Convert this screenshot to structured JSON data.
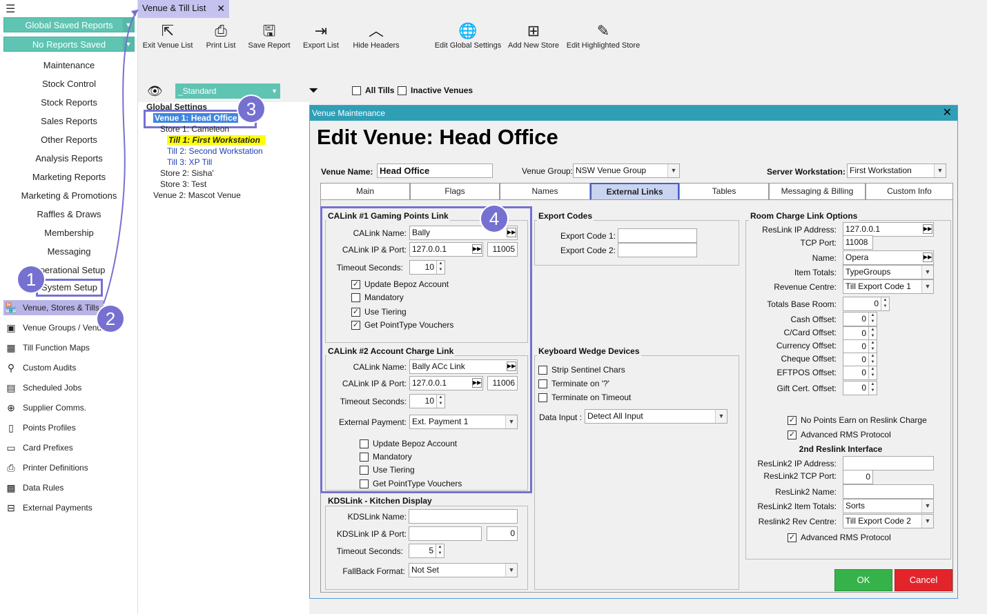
{
  "sidebar": {
    "dropdowns": [
      "Global Saved Reports",
      "No Reports Saved"
    ],
    "menu": [
      "Maintenance",
      "Stock Control",
      "Stock Reports",
      "Sales Reports",
      "Other Reports",
      "Analysis Reports",
      "Marketing Reports",
      "Marketing & Promotions",
      "Raffles & Draws",
      "Membership",
      "Messaging",
      "Operational Setup",
      "System Setup"
    ],
    "icon_items": [
      {
        "label": "Venue, Stores & Tills",
        "icon": "venue-icon"
      },
      {
        "label": "Venue Groups / Venues",
        "icon": "venue-groups-icon"
      },
      {
        "label": "Till Function Maps",
        "icon": "grid-icon"
      },
      {
        "label": "Custom Audits",
        "icon": "audit-icon"
      },
      {
        "label": "Scheduled Jobs",
        "icon": "calendar-icon"
      },
      {
        "label": "Supplier Comms.",
        "icon": "upload-icon"
      },
      {
        "label": "Points Profiles",
        "icon": "document-icon"
      },
      {
        "label": "Card Prefixes",
        "icon": "card-icon"
      },
      {
        "label": "Printer Definitions",
        "icon": "printer-icon"
      },
      {
        "label": "Data Rules",
        "icon": "table-icon"
      },
      {
        "label": "External Payments",
        "icon": "payment-icon"
      }
    ]
  },
  "tab": {
    "title": "Venue & Till List",
    "close": "✕"
  },
  "toolbar": [
    {
      "label": "Exit Venue List",
      "icon": "exit-icon"
    },
    {
      "label": "Print List",
      "icon": "print-icon"
    },
    {
      "label": "Save Report",
      "icon": "save-icon"
    },
    {
      "label": "Export List",
      "icon": "export-icon"
    },
    {
      "label": "Hide Headers",
      "icon": "chevron-up-icon"
    },
    {
      "label": "Edit Global Settings",
      "icon": "globe-icon"
    },
    {
      "label": "Add New Store",
      "icon": "add-store-icon"
    },
    {
      "label": "Edit Highlighted Store",
      "icon": "edit-store-icon"
    }
  ],
  "filter": {
    "view": "_Standard",
    "all_tills": "All Tills",
    "inactive_venues": "Inactive Venues"
  },
  "tree": {
    "global": "Global Settings",
    "venue1": "Venue 1: Head Office",
    "store1": "Store 1: Cameleon",
    "till1": "Till 1: First Workstation",
    "till2": "Till 2: Second Workstation",
    "till3": "Till 3: XP Till",
    "store2": "Store 2: Sisha'",
    "store3": "Store 3: Test",
    "venue2": "Venue 2: Mascot Venue"
  },
  "bubbles": [
    "1",
    "2",
    "3",
    "4"
  ],
  "dialog": {
    "title": "Venue Maintenance",
    "close": "✕",
    "heading": "Edit Venue: Head Office",
    "venue_name_label": "Venue Name:",
    "venue_name": "Head Office",
    "venue_group_label": "Venue Group:",
    "venue_group": "NSW Venue Group",
    "server_ws_label": "Server Workstation:",
    "server_ws": "First Workstation",
    "tabs": [
      "Main",
      "Flags",
      "Names",
      "External Links",
      "Tables",
      "Messaging & Billing",
      "Custom Info"
    ],
    "calink1": {
      "title": "CALink #1 Gaming Points Link",
      "name_label": "CALink Name:",
      "name": "Bally",
      "ip_label": "CALink IP & Port:",
      "ip": "127.0.0.1",
      "port": "11005",
      "timeout_label": "Timeout Seconds:",
      "timeout": "10",
      "checks": [
        {
          "label": "Update Bepoz Account",
          "checked": "✓"
        },
        {
          "label": "Mandatory",
          "checked": ""
        },
        {
          "label": "Use Tiering",
          "checked": "✓"
        },
        {
          "label": "Get PointType Vouchers",
          "checked": "✓"
        }
      ]
    },
    "calink2": {
      "title": "CALink #2 Account Charge Link",
      "name_label": "CALink Name:",
      "name": "Bally ACc Link",
      "ip_label": "CALink IP & Port:",
      "ip": "127.0.0.1",
      "port": "11006",
      "timeout_label": "Timeout Seconds:",
      "timeout": "10",
      "ext_label": "External Payment:",
      "ext": "Ext. Payment 1",
      "checks": [
        {
          "label": "Update Bepoz Account",
          "checked": ""
        },
        {
          "label": "Mandatory",
          "checked": ""
        },
        {
          "label": "Use Tiering",
          "checked": ""
        },
        {
          "label": "Get PointType Vouchers",
          "checked": ""
        }
      ]
    },
    "kds": {
      "title": "KDSLink - Kitchen Display",
      "name_label": "KDSLink Name:",
      "name": "",
      "ip_label": "KDSLink IP & Port:",
      "ip": "",
      "port": "0",
      "timeout_label": "Timeout Seconds:",
      "timeout": "5",
      "fallback_label": "FallBack Format:",
      "fallback": "Not Set"
    },
    "export": {
      "title": "Export Codes",
      "code1_label": "Export Code 1:",
      "code2_label": "Export Code 2:"
    },
    "wedge": {
      "title": "Keyboard Wedge Devices",
      "checks": [
        "Strip Sentinel Chars",
        "Terminate on '?'",
        "Terminate on Timeout"
      ],
      "data_input_label": "Data Input :",
      "data_input": "Detect All Input"
    },
    "room": {
      "title": "Room Charge Link Options",
      "ip_label": "ResLink  IP Address:",
      "ip": "127.0.0.1",
      "tcp_label": "TCP Port:",
      "tcp": "11008",
      "name_label": "Name:",
      "name": "Opera",
      "item_totals_label": "Item Totals:",
      "item_totals": "TypeGroups",
      "revenue_label": "Revenue Centre:",
      "revenue": "Till Export Code 1",
      "base_room_label": "Totals Base Room:",
      "base_room": "0",
      "offsets": [
        {
          "label": "Cash Offset:",
          "value": "0"
        },
        {
          "label": "C/Card Offset:",
          "value": "0"
        },
        {
          "label": "Currency Offset:",
          "value": "0"
        },
        {
          "label": "Cheque Offset:",
          "value": "0"
        },
        {
          "label": "EFTPOS Offset:",
          "value": "0"
        },
        {
          "label": "Gift Cert. Offset:",
          "value": "0"
        }
      ],
      "no_points": "No Points Earn on Reslink Charge",
      "adv_rms": "Advanced RMS Protocol",
      "second": "2nd Reslink Interface",
      "ip2_label": "ResLink2  IP Address:",
      "ip2": "",
      "tcp2_label": "ResLink2 TCP Port:",
      "tcp2": "0",
      "name2_label": "ResLink2 Name:",
      "name2": "",
      "items2_label": "ResLink2 Item Totals:",
      "items2": "Sorts",
      "rev2_label": "Reslink2 Rev Centre:",
      "rev2": "Till Export Code 2",
      "adv_rms2": "Advanced RMS Protocol"
    },
    "ok": "OK",
    "cancel": "Cancel"
  }
}
